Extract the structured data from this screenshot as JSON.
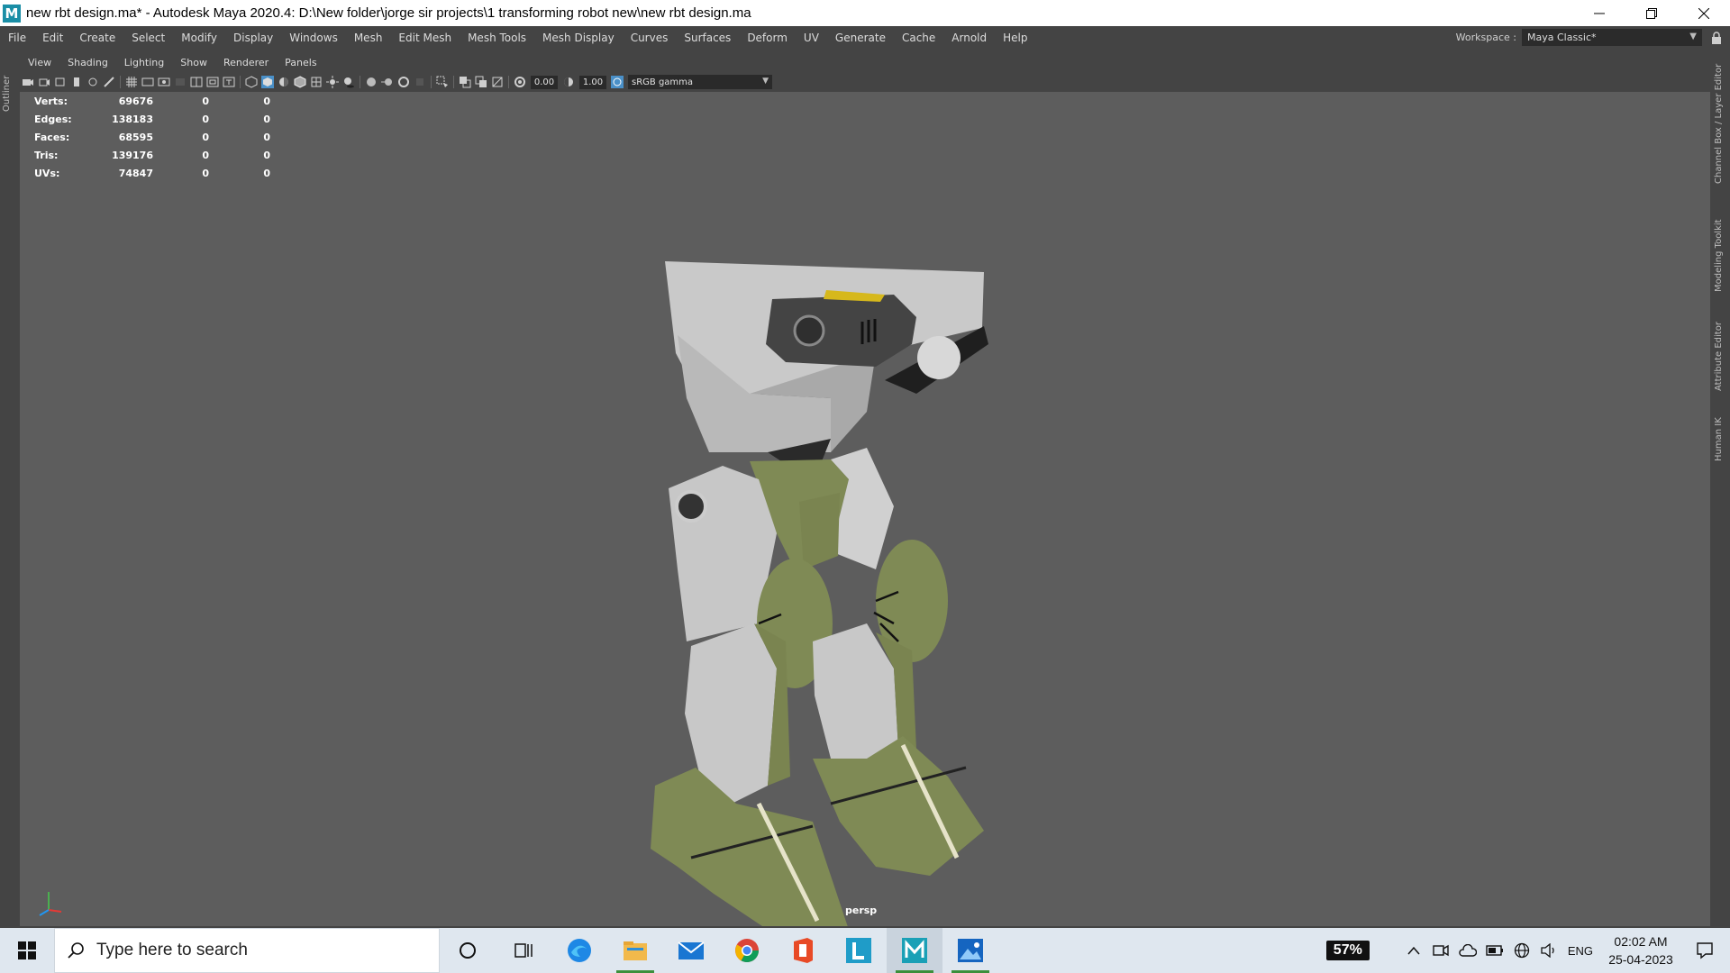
{
  "window": {
    "title": "new rbt design.ma* - Autodesk Maya 2020.4: D:\\New folder\\jorge sir projects\\1 transforming robot new\\new rbt design.ma",
    "app_logo": "M"
  },
  "menubar": {
    "items": [
      "File",
      "Edit",
      "Create",
      "Select",
      "Modify",
      "Display",
      "Windows",
      "Mesh",
      "Edit Mesh",
      "Mesh Tools",
      "Mesh Display",
      "Curves",
      "Surfaces",
      "Deform",
      "UV",
      "Generate",
      "Cache",
      "Arnold",
      "Help"
    ]
  },
  "workspace": {
    "label": "Workspace :",
    "value": "Maya Classic*"
  },
  "left_strip": {
    "label": "Outliner"
  },
  "right_strip": {
    "labels": [
      "Channel Box / Layer Editor",
      "Modeling Toolkit",
      "Attribute Editor",
      "Human IK"
    ]
  },
  "panel_menu": {
    "items": [
      "View",
      "Shading",
      "Lighting",
      "Show",
      "Renderer",
      "Panels"
    ]
  },
  "toolbar": {
    "exposure": "0.00",
    "gamma": "1.00",
    "color_management": "sRGB gamma"
  },
  "hud": {
    "rows": [
      {
        "label": "Verts:",
        "value": "69676",
        "sel": "0",
        "comp": "0"
      },
      {
        "label": "Edges:",
        "value": "138183",
        "sel": "0",
        "comp": "0"
      },
      {
        "label": "Faces:",
        "value": "68595",
        "sel": "0",
        "comp": "0"
      },
      {
        "label": "Tris:",
        "value": "139176",
        "sel": "0",
        "comp": "0"
      },
      {
        "label": "UVs:",
        "value": "74847",
        "sel": "0",
        "comp": "0"
      }
    ]
  },
  "viewport": {
    "camera": "persp"
  },
  "taskbar": {
    "search_placeholder": "Type here to search",
    "battery": "57%",
    "language": "ENG",
    "time": "02:02 AM",
    "date": "25-04-2023"
  },
  "colors": {
    "viewport_bg": "#5d5d5d",
    "ui_bg": "#444444",
    "robot_gray": "#c4c4c4",
    "robot_olive": "#7f8a55",
    "accent_yellow": "#d6b81c"
  }
}
